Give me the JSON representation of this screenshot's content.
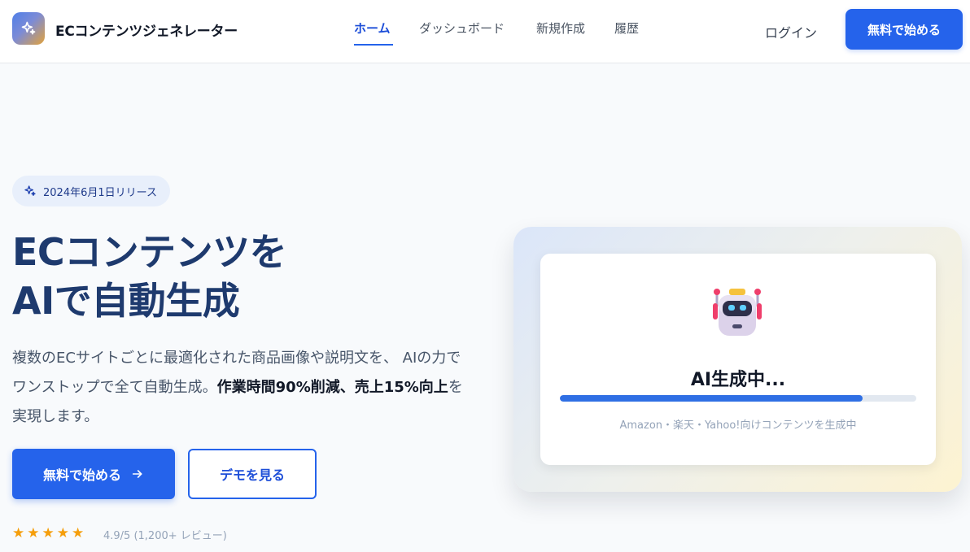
{
  "header": {
    "brand": "ECコンテンツジェネレーター",
    "nav": [
      {
        "label": "ホーム",
        "active": true
      },
      {
        "label": "ダッシュボード",
        "active": false
      },
      {
        "label": "新規作成",
        "active": false
      },
      {
        "label": "履歴",
        "active": false
      }
    ],
    "login_label": "ログイン",
    "cta_label": "無料で始める"
  },
  "hero": {
    "badge": "2024年6月1日リリース",
    "headline_line1": "ECコンテンツを",
    "headline_line2": "AIで自動生成",
    "desc_part1": "複数のECサイトごとに最適化された商品画像や説明文を、 AIの力でワンストップで全て自動生成。",
    "desc_bold": "作業時間90%削減、売上15%向上",
    "desc_part2": "を実現します。",
    "primary_button": "無料で始める",
    "secondary_button": "デモを見る",
    "stars": 5,
    "rating_text": "4.9/5 (1,200+ レビュー)"
  },
  "generator_card": {
    "title": "AI生成中...",
    "progress_percent": 85,
    "subtitle": "Amazon・楽天・Yahoo!向けコンテンツを生成中"
  },
  "colors": {
    "accent": "#2563eb",
    "headline": "#1e3a6e",
    "star": "#f59e0b"
  },
  "icons": {
    "logo": "sparkles-icon",
    "badge": "sparkles-icon",
    "cta_arrow": "arrow-right-icon",
    "card": "robot-icon",
    "rating": "star-icon"
  }
}
